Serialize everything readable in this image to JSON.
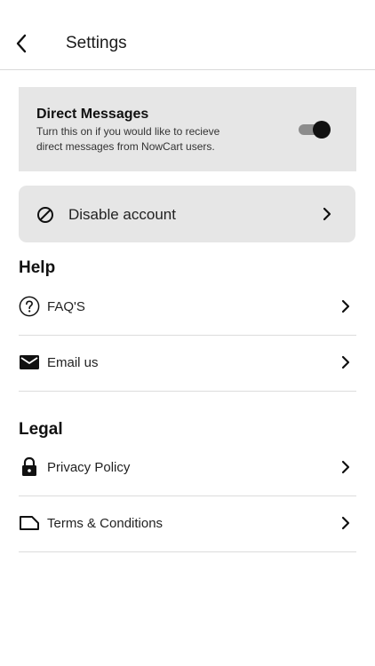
{
  "header": {
    "title": "Settings",
    "back_icon": "chevron-left-icon"
  },
  "direct_messages": {
    "title": "Direct Messages",
    "description": "Turn this on if you would like to recieve direct messages from NowCart users.",
    "enabled": true
  },
  "disable_account": {
    "label": "Disable account",
    "icon": "block-icon"
  },
  "help": {
    "title": "Help",
    "items": [
      {
        "label": "FAQ'S",
        "icon": "help-circle-icon"
      },
      {
        "label": "Email us",
        "icon": "mail-icon"
      }
    ]
  },
  "legal": {
    "title": "Legal",
    "items": [
      {
        "label": "Privacy Policy",
        "icon": "lock-icon"
      },
      {
        "label": "Terms & Conditions",
        "icon": "label-tag-icon"
      }
    ]
  },
  "colors": {
    "card_bg": "#e6e6e6",
    "divider": "#dcdcdc",
    "toggle_knob": "#111111",
    "toggle_track": "#8c8c8c"
  }
}
